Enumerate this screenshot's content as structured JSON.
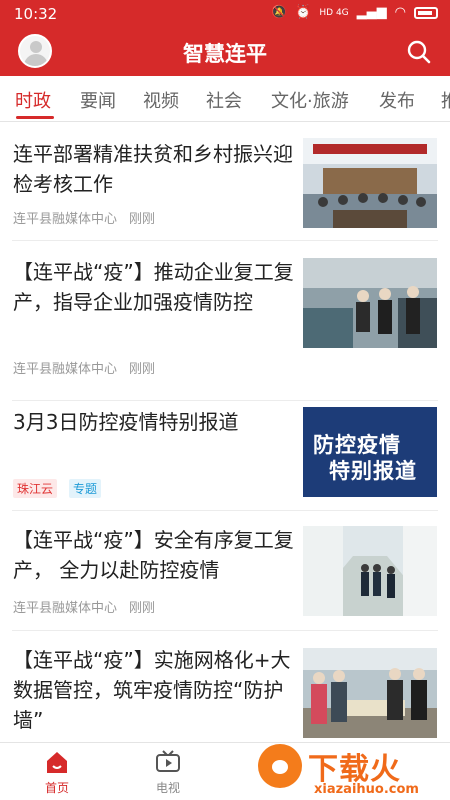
{
  "status": {
    "time": "10:32",
    "network": "HD 4G"
  },
  "app": {
    "title": "智慧连平"
  },
  "tabs": [
    {
      "label": "时政",
      "active": true
    },
    {
      "label": "要闻"
    },
    {
      "label": "视频"
    },
    {
      "label": "社会"
    },
    {
      "label": "文化·旅游"
    },
    {
      "label": "发布"
    },
    {
      "label": "推"
    }
  ],
  "feed": [
    {
      "title": "连平部署精准扶贫和乡村振兴迎检考核工作",
      "source": "连平县融媒体中心",
      "time": "刚刚",
      "thumb": "meeting-room"
    },
    {
      "title": "【连平战“疫”】推动企业复工复产，指导企业加强疫情防控",
      "source": "连平县融媒体中心",
      "time": "刚刚",
      "thumb": "factory-inspection"
    },
    {
      "title": "3月3日防控疫情特别报道",
      "tags": [
        "珠江云",
        "专题"
      ],
      "thumb_text": [
        "防控疫情",
        "特别报道"
      ]
    },
    {
      "title": "【连平战“疫”】安全有序复工复产， 全力以赴防控疫情",
      "source": "连平县融媒体中心",
      "time": "刚刚",
      "thumb": "corridor-inspection"
    },
    {
      "title": "【连平战“疫”】实施网格化+大数据管控，筑牢疫情防控“防护墙”",
      "thumb": "outdoor-checkpoint"
    }
  ],
  "bottom_nav": [
    {
      "label": "首页",
      "icon": "home-icon",
      "active": true
    },
    {
      "label": "电视",
      "icon": "tv-icon"
    }
  ],
  "watermark": {
    "text": "下载火",
    "url": "xiazaihuo.com"
  },
  "colors": {
    "brand": "#d62a2a",
    "watermark": "#f06a1a"
  }
}
